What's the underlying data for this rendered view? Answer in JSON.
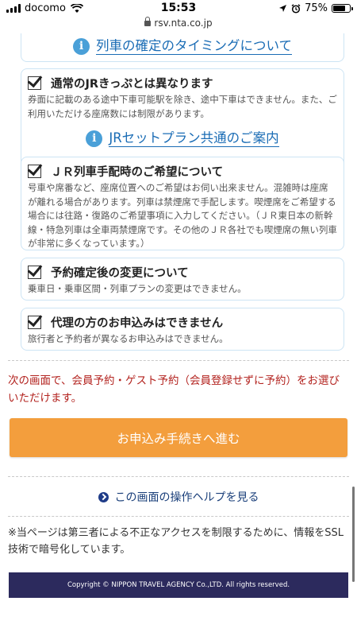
{
  "status_bar": {
    "carrier": "docomo",
    "time": "15:53",
    "battery": "75%",
    "battery_level": 0.75
  },
  "browser": {
    "url": "rsv.nta.co.jp"
  },
  "cards": {
    "timing_link": "列車の確定のタイミングについて",
    "ticket": {
      "title": "通常のJRきっぷとは異なります",
      "body": "券面に記載のある途中下車可能駅を除き、途中下車はできません。また、ご利用いただける座席数には制限があります。",
      "link": "JRセットプラン共通のご案内"
    },
    "seat": {
      "title": "ＪＲ列車手配時のご希望について",
      "body": "号車や席番など、座席位置へのご希望はお伺い出来ません。混雑時は座席が離れる場合があります。列車は禁煙席で手配します。喫煙席をご希望する場合には往路・復路のご希望事項に入力してください。（ＪＲ東日本の新幹線・特急列車は全車両禁煙席です。その他のＪＲ各社でも喫煙席の無い列車が非常に多くなっています。）"
    },
    "change": {
      "title": "予約確定後の変更について",
      "body": "乗車日・乗車区間・列車プランの変更はできません。"
    },
    "proxy": {
      "title": "代理の方のお申込みはできません",
      "body": "旅行者と予約者が異なるお申込みはできません。"
    }
  },
  "notice": "次の画面で、会員予約・ゲスト予約（会員登録せずに予約）をお選びいただけます。",
  "proceed_button": "お申込み手続きへ進む",
  "help_link": "この画面の操作ヘルプを見る",
  "ssl_note": "※当ページは第三者による不正なアクセスを制限するために、情報をSSL技術で暗号化しています。",
  "footer": "Copyright © NIPPON TRAVEL AGENCY Co.,LTD. All rights reserved.",
  "colors": {
    "button": "#f39e3d",
    "notice": "#b3231f",
    "link": "#1a6cb5",
    "footer": "#2c2a5d"
  }
}
